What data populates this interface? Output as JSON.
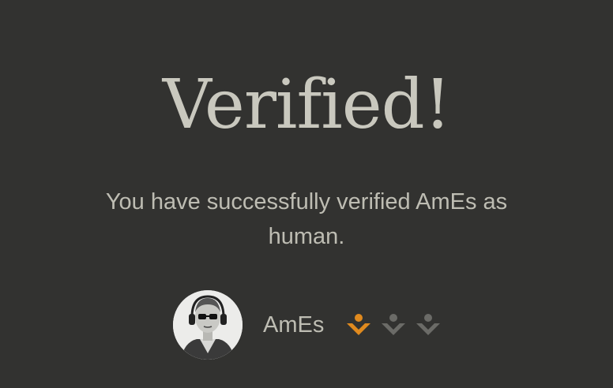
{
  "heading": "Verified!",
  "message": "You have successfully verified AmEs as human.",
  "user": {
    "name": "AmEs",
    "avatar_icon": "avatar-person-headphones-sunglasses"
  },
  "badges": [
    {
      "icon": "verification-badge-icon",
      "active": true,
      "color": "#e08a1e"
    },
    {
      "icon": "verification-badge-icon",
      "active": false,
      "color": "#6b6b67"
    },
    {
      "icon": "verification-badge-icon",
      "active": false,
      "color": "#6b6b67"
    }
  ],
  "colors": {
    "background": "#323230",
    "heading": "#c9c8be",
    "text": "#bebdb3",
    "accent": "#e08a1e",
    "inactive": "#6b6b67"
  }
}
